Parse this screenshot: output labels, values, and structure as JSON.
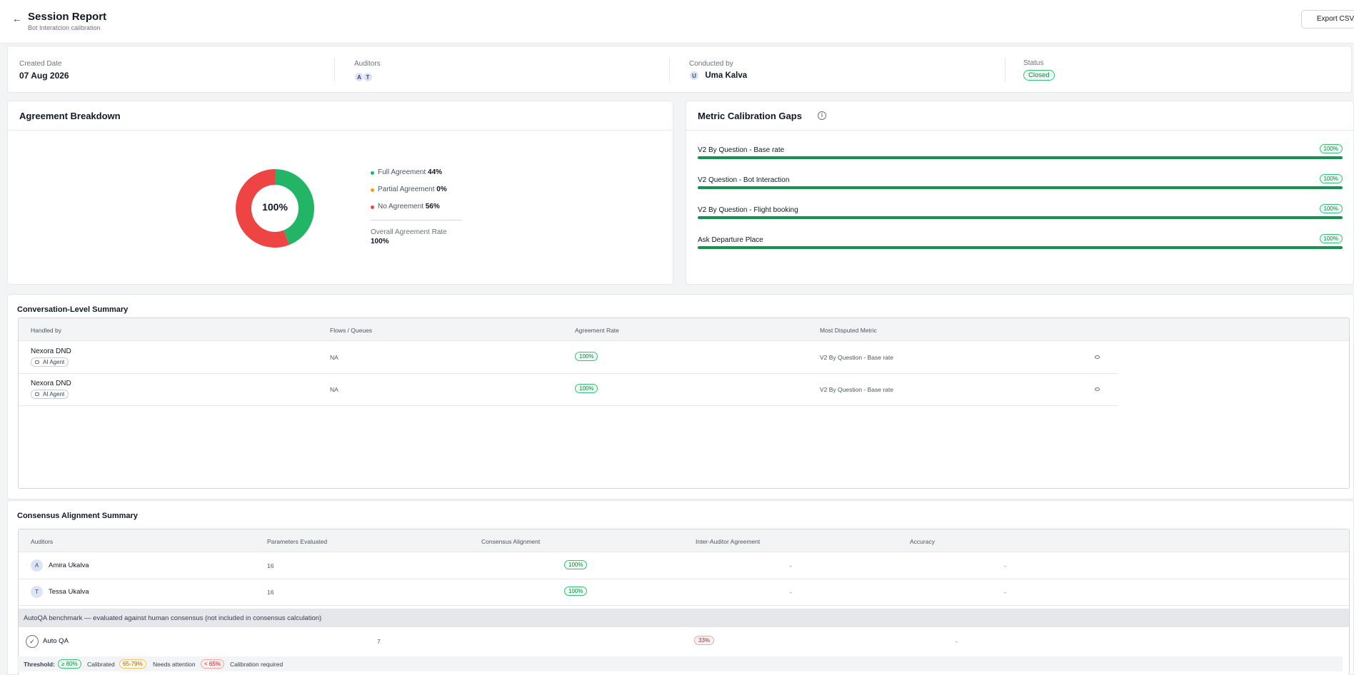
{
  "header": {
    "title": "Session Report",
    "subtitle": "Bot Interatcion calibration",
    "export_label": "Export CSV"
  },
  "info": {
    "created_label": "Created Date",
    "created_value": "07 Aug 2026",
    "auditors_label": "Auditors",
    "auditor_initials": [
      "A",
      "T"
    ],
    "conducted_label": "Conducted by",
    "conducted_initial": "U",
    "conducted_value": "Uma Kalva",
    "status_label": "Status",
    "status_value": "Closed"
  },
  "agreement": {
    "title": "Agreement Breakdown",
    "center_label": "100%",
    "legend": [
      {
        "label": "Full Agreement",
        "value": "44%",
        "color": "#22b565"
      },
      {
        "label": "Partial Agreement",
        "value": "0%",
        "color": "#f59e0b"
      },
      {
        "label": "No Agreement",
        "value": "56%",
        "color": "#ef4444"
      }
    ],
    "overall_label": "Overall Agreement Rate",
    "overall_value": "100%"
  },
  "chart_data": {
    "type": "pie",
    "categories": [
      "Full Agreement",
      "Partial Agreement",
      "No Agreement"
    ],
    "values": [
      44,
      0,
      56
    ],
    "colors": [
      "#22b565",
      "#f59e0b",
      "#ef4444"
    ]
  },
  "gaps": {
    "title": "Metric Calibration Gaps",
    "items": [
      {
        "name": "V2 By Question - Base rate",
        "value": "100%",
        "fraction": 1.0
      },
      {
        "name": "V2 Question - Bot Interaction",
        "value": "100%",
        "fraction": 1.0
      },
      {
        "name": "V2 By Question - Flight booking",
        "value": "100%",
        "fraction": 1.0
      },
      {
        "name": "Ask Departure Place",
        "value": "100%",
        "fraction": 1.0
      }
    ]
  },
  "conversation": {
    "title": "Conversation-Level Summary",
    "columns": [
      "Handled by",
      "Flows / Queues",
      "Agreement Rate",
      "Most Disputed Metric"
    ],
    "rows": [
      {
        "name": "Nexora DND",
        "tag": "AI Agent",
        "flows": "NA",
        "rate": "100%",
        "metric": "V2 By Question - Base rate"
      },
      {
        "name": "Nexora DND",
        "tag": "AI Agent",
        "flows": "NA",
        "rate": "100%",
        "metric": "V2 By Question - Base rate"
      }
    ]
  },
  "consensus": {
    "title": "Consensus Alignment Summary",
    "columns": [
      "Auditors",
      "Parameters Evaluated",
      "Consensus Alignment",
      "Inter-Auditor Agreement",
      "Accuracy"
    ],
    "rows": [
      {
        "initial": "A",
        "name": "Amira Ukalva",
        "params": "16",
        "alignment": "100%",
        "inter": "-",
        "accuracy": "-"
      },
      {
        "initial": "T",
        "name": "Tessa Ukalva",
        "params": "16",
        "alignment": "100%",
        "inter": "-",
        "accuracy": "-"
      }
    ],
    "benchmark_note": "AutoQA benchmark — evaluated against human consensus (not included in consensus calculation)",
    "autoqa": {
      "name": "Auto QA",
      "params": "7",
      "alignment": "33%",
      "inter": "-"
    }
  },
  "threshold": {
    "label": "Threshold:",
    "items": [
      {
        "pill": "≥ 80%",
        "text": "Calibrated"
      },
      {
        "pill": "65-79%",
        "text": "Needs attention"
      },
      {
        "pill": "< 65%",
        "text": "Calibration required"
      }
    ]
  }
}
